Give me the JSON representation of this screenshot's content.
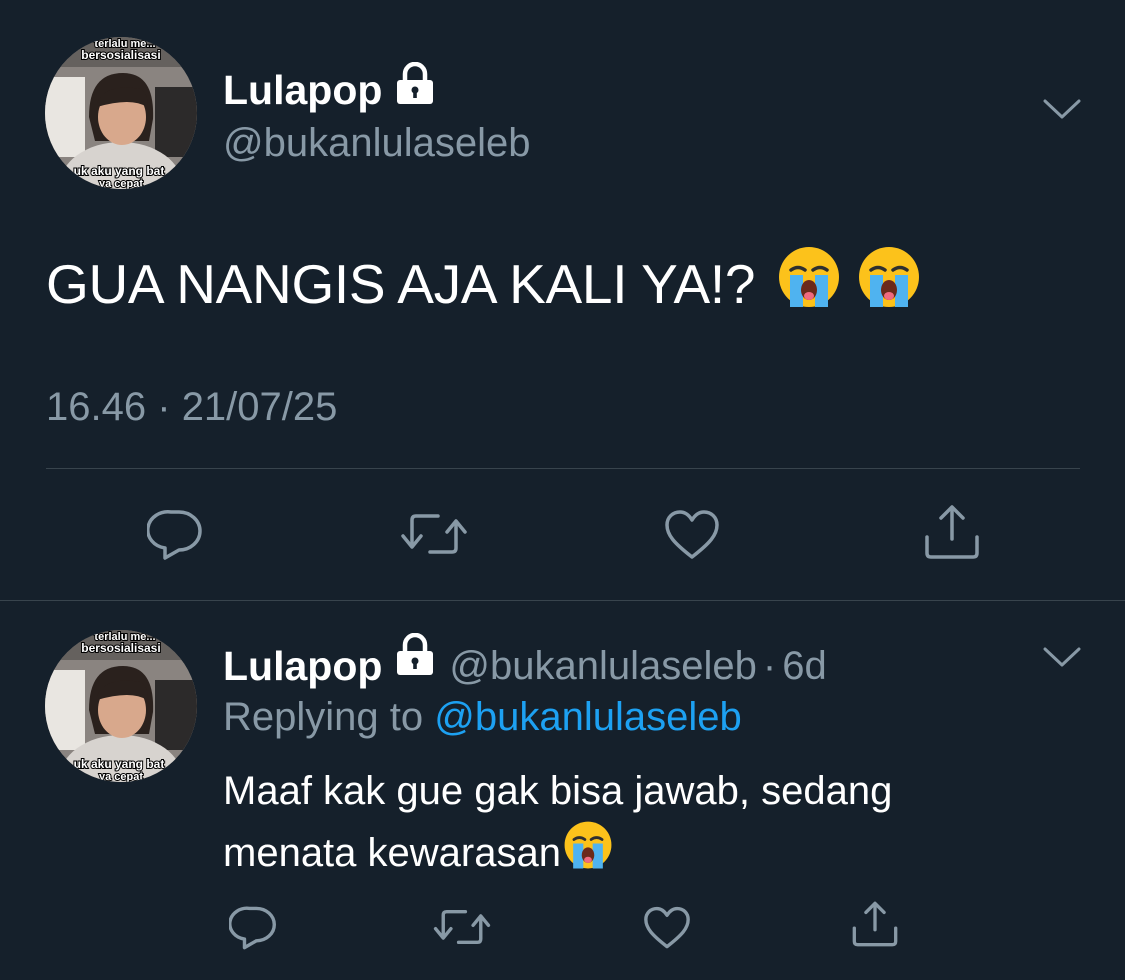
{
  "main_tweet": {
    "display_name": "Lulapop",
    "handle": "@bukanlulaseleb",
    "text": "GUA NANGIS AJA KALI YA!?",
    "time": "16.46",
    "separator": "·",
    "date": "21/07/25",
    "emojis": [
      "loudly-crying-face",
      "loudly-crying-face"
    ]
  },
  "avatar": {
    "caption_top": "terlalu me... bersosialisasi",
    "caption_bottom": "...uk aku yang bat... ...ya cepat..."
  },
  "reply_tweet": {
    "display_name": "Lulapop",
    "handle": "@bukanlulaseleb",
    "separator": "·",
    "time": "6d",
    "replying_label": "Replying to",
    "replying_to": "@bukanlulaseleb",
    "text_line1": "Maaf kak gue gak bisa jawab, sedang",
    "text_line2": "menata kewarasan",
    "emojis": [
      "loudly-crying-face"
    ]
  },
  "actions": [
    "reply-icon",
    "retweet-icon",
    "like-icon",
    "share-icon"
  ],
  "colors": {
    "background": "#15202b",
    "text": "#ffffff",
    "secondary": "#8899a6",
    "link": "#1da1f2",
    "divider": "#38444d"
  }
}
